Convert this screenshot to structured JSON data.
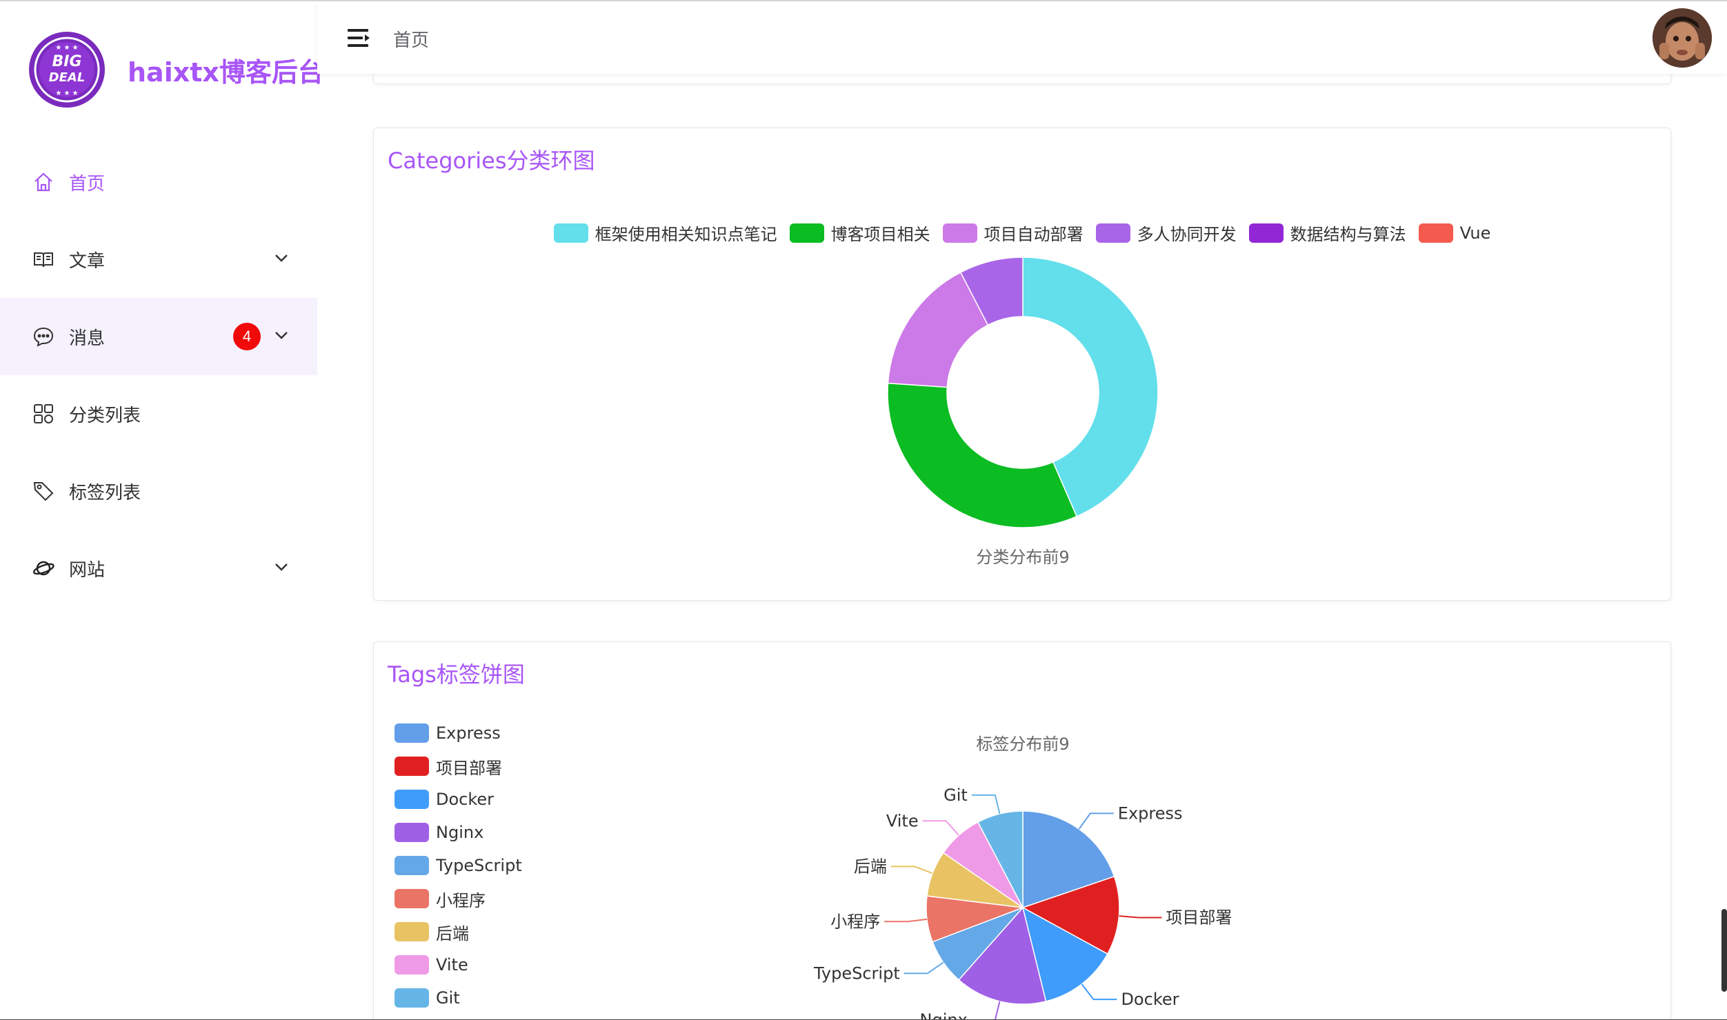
{
  "sidebar": {
    "brand_title": "haixtx博客后台",
    "logo_text_top": "BIG",
    "logo_text_bottom": "DEAL",
    "items": [
      {
        "label": "首页",
        "icon": "home-icon"
      },
      {
        "label": "文章",
        "icon": "book-icon"
      },
      {
        "label": "消息",
        "icon": "chat-icon",
        "badge": "4"
      },
      {
        "label": "分类列表",
        "icon": "grid-icon"
      },
      {
        "label": "标签列表",
        "icon": "tag-icon"
      },
      {
        "label": "网站",
        "icon": "planet-icon"
      }
    ]
  },
  "header": {
    "breadcrumb": "首页"
  },
  "colors": {
    "accent": "#a855f7",
    "badge": "#f00a0a"
  },
  "categories_card": {
    "title": "Categories分类环图",
    "subtitle": "分类分布前9"
  },
  "tags_card": {
    "title": "Tags标签饼图",
    "subtitle": "标签分布前9"
  },
  "chart_data": [
    {
      "type": "pie",
      "variant": "donut",
      "title": "分类分布前9",
      "legend": [
        "框架使用相关知识点笔记",
        "博客项目相关",
        "项目自动部署",
        "多人协同开发",
        "数据结构与算法",
        "Vue"
      ],
      "legend_colors": [
        "#62dfeb",
        "#0bbc22",
        "#cc7ae8",
        "#a965e8",
        "#9227d6",
        "#f55a4e"
      ],
      "values": [
        {
          "name": "框架使用相关知识点笔记",
          "value": 4,
          "color": "#62dfeb"
        },
        {
          "name": "博客项目相关",
          "value": 3,
          "color": "#0bbc22"
        },
        {
          "name": "项目自动部署",
          "value": 1.5,
          "color": "#cc7ae8"
        },
        {
          "name": "多人协同开发",
          "value": 0.7,
          "color": "#a965e8"
        }
      ],
      "legend_placement": "top-center"
    },
    {
      "type": "pie",
      "title": "标签分布前9",
      "values": [
        {
          "name": "Express",
          "value": 18,
          "color": "#639ee8"
        },
        {
          "name": "项目部署",
          "value": 12,
          "color": "#e02020"
        },
        {
          "name": "Docker",
          "value": 12,
          "color": "#3f9cfa"
        },
        {
          "name": "Nginx",
          "value": 14,
          "color": "#a060e6"
        },
        {
          "name": "TypeScript",
          "value": 7,
          "color": "#64a8e8"
        },
        {
          "name": "小程序",
          "value": 7,
          "color": "#ea7466"
        },
        {
          "name": "后端",
          "value": 7,
          "color": "#e9c363"
        },
        {
          "name": "Vite",
          "value": 7,
          "color": "#ef9ae6"
        },
        {
          "name": "Git",
          "value": 7,
          "color": "#65b6e7"
        }
      ],
      "legend_placement": "left"
    }
  ]
}
